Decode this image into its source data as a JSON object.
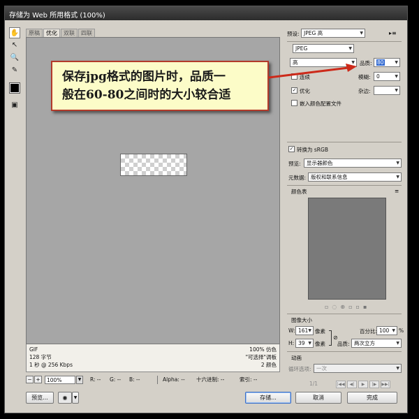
{
  "window": {
    "title": "存储为 Web 所用格式 (100%)"
  },
  "tabs": [
    "原稿",
    "优化",
    "双联",
    "四联"
  ],
  "active_tab": 1,
  "infobar": {
    "format": "GIF",
    "size": "128 字节",
    "speed": "1 秒 @ 256 Kbps",
    "dither": "100% 仿色",
    "palette": "\"可选择\"调板",
    "colors": "2 颜色"
  },
  "statusbar": {
    "zoom": "100%",
    "r": "R: --",
    "g": "G: --",
    "b": "B: --",
    "alpha": "Alpha: --",
    "hex": "十六进制: --",
    "index": "索引: --"
  },
  "buttons": {
    "preview": "预览...",
    "save": "存储...",
    "cancel": "取消",
    "done": "完成"
  },
  "settings": {
    "preset_label": "预设:",
    "preset_value": "JPEG 高",
    "format_value": "JPEG",
    "quality_level": "高",
    "quality_label": "品质:",
    "quality_value": "80",
    "progressive_label": "连续",
    "blur_label": "模糊:",
    "blur_value": "0",
    "optimized_label": "优化",
    "matte_label": "杂边:",
    "embed_profile_label": "嵌入颜色配置文件",
    "convert_srgb_label": "转换为 sRGB",
    "preview_label": "预览:",
    "preview_value": "显示器颜色",
    "metadata_label": "元数据:",
    "metadata_value": "版权和联系信息",
    "color_table_label": "颜色表",
    "image_size_label": "图像大小",
    "w_label": "W:",
    "w_value": "161",
    "h_label": "H:",
    "h_value": "39",
    "pixel_unit": "像素",
    "percent_label": "百分比:",
    "percent_value": "100",
    "percent_unit": "%",
    "resample_label": "品质:",
    "resample_value": "两次立方",
    "animation_label": "动画",
    "loop_label": "循环选项:",
    "loop_value": "一次",
    "frame_counter": "1/1"
  },
  "annotation": {
    "line1": "保存jpg格式的图片时，品质一",
    "line2": "般在60-80之间时的大小较合适"
  },
  "colors": {
    "callout_bg": "#fcfcc8",
    "callout_border": "#b23a2a",
    "arrow": "#cc2a1a"
  }
}
